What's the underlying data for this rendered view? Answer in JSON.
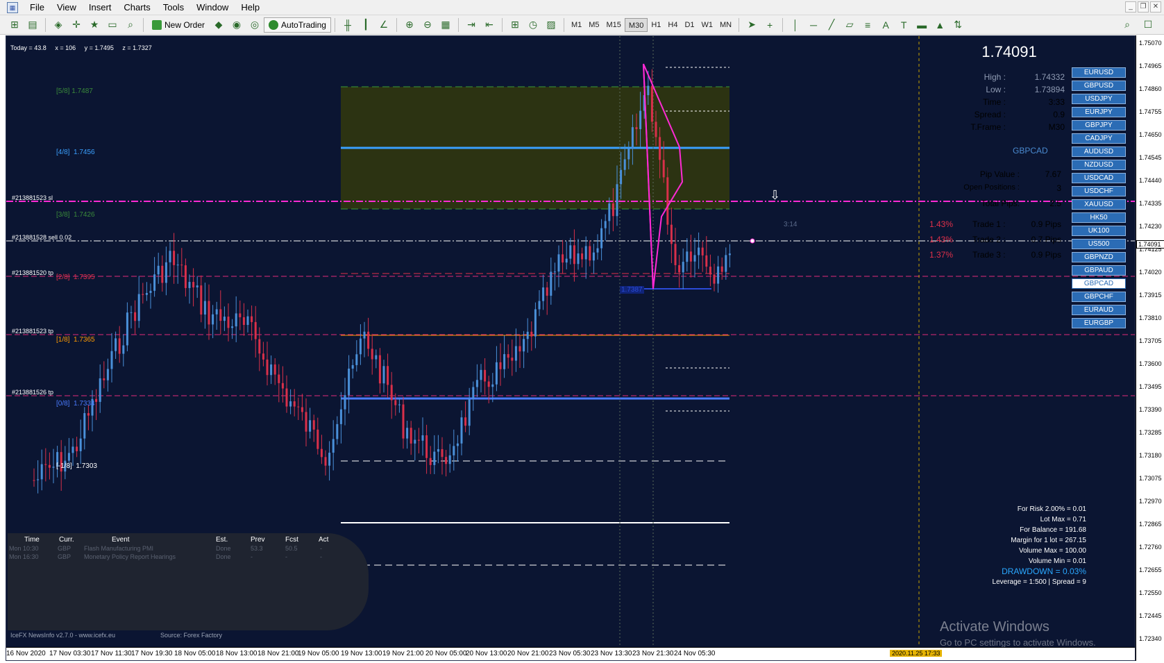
{
  "menu": {
    "app_icon": "mt4-icon",
    "items": [
      "File",
      "View",
      "Insert",
      "Charts",
      "Tools",
      "Window",
      "Help"
    ]
  },
  "toolbar": {
    "new_order_label": "New Order",
    "autotrading_label": "AutoTrading",
    "timeframes": [
      "M1",
      "M5",
      "M15",
      "M30",
      "H1",
      "H4",
      "D1",
      "W1",
      "MN"
    ],
    "active_timeframe": "M30"
  },
  "chart": {
    "info": {
      "today": "Today = 43.8",
      "x": "x = 106",
      "y": "y = 1.7495",
      "z": "z = 1.7327"
    },
    "murrey_levels": [
      {
        "label": "[5/8]",
        "value": "1.7487",
        "color": "#3a8a3a"
      },
      {
        "label": "[4/8]",
        "value": "1.7456",
        "color": "#3aa0ff"
      },
      {
        "label": "[3/8]",
        "value": "1.7426",
        "color": "#3a8a3a"
      },
      {
        "label": "[2/8]",
        "value": "1.7395",
        "color": "#e0304a"
      },
      {
        "label": "[1/8]",
        "value": "1.7365",
        "color": "#ff9a00"
      },
      {
        "label": "[0/8]",
        "value": "1.7334",
        "color": "#4a7bff"
      },
      {
        "label": "[-1/8]",
        "value": "1.7303",
        "color": "#ffffff"
      }
    ],
    "order_tags": [
      "#213881523 sl",
      "#213881528 sell 0.02",
      "#213881520 tp",
      "#213881523 tp",
      "#213881526 tp"
    ],
    "countdown": "3:14",
    "low_marker": "1.7387"
  },
  "panel": {
    "price": "1.74091",
    "high_label": "High :",
    "high": "1.74332",
    "low_label": "Low :",
    "low": "1.73894",
    "time_label": "Time :",
    "time": "3:33",
    "spread_label": "Spread :",
    "spread": "0.9",
    "tframe_label": "T.Frame :",
    "tframe": "M30",
    "symbol": "GBPCAD",
    "pip_value_label": "Pip Value :",
    "pip_value": "7.67",
    "open_pos_label": "Open Positions :",
    "open_pos": "3",
    "total_pips_label": "Total Pips:",
    "total_pips": "2.5",
    "trades": [
      {
        "pct": "1.43%",
        "label": "Trade 1 :",
        "pips": "0.9 Pips"
      },
      {
        "pct": "1.43%",
        "label": "Trade 2 :",
        "pips": "0.7 Pips"
      },
      {
        "pct": "1.37%",
        "label": "Trade 3 :",
        "pips": "0.9 Pips"
      }
    ]
  },
  "symbols": [
    "EURUSD",
    "GBPUSD",
    "USDJPY",
    "EURJPY",
    "GBPJPY",
    "CADJPY",
    "AUDUSD",
    "NZDUSD",
    "USDCAD",
    "USDCHF",
    "XAUUSD",
    "HK50",
    "UK100",
    "US500",
    "GBPNZD",
    "GBPAUD",
    "GBPCAD",
    "GBPCHF",
    "EURAUD",
    "EURGBP"
  ],
  "selected_symbol": "GBPCAD",
  "account": {
    "risk": "For Risk 2.00% = 0.01",
    "lot_max": "Lot Max = 0.71",
    "balance": "For Balance = 191.68",
    "margin": "Margin for 1 lot = 267.15",
    "vol_max": "Volume Max = 100.00",
    "vol_min": "Volume Min = 0.01",
    "drawdown": "DRAWDOWN =  0.03%",
    "leverage": "Leverage = 1:500 | Spread = 9"
  },
  "news": {
    "headers": [
      "Time",
      "Curr.",
      "Event",
      "Est.",
      "Prev",
      "Fcst",
      "Act"
    ],
    "rows": [
      [
        "Mon 10:30",
        "GBP",
        "Flash Manufacturing PMI",
        "Done",
        "53.3",
        "50.5",
        "-"
      ],
      [
        "Mon 16:30",
        "GBP",
        "Monetary Policy Report Hearings",
        "Done",
        "-",
        "-",
        "-"
      ]
    ],
    "footer_left": "IceFX NewsInfo v2.7.0  -  www.icefx.eu",
    "footer_right": "Source: Forex Factory"
  },
  "price_axis": {
    "ticks": [
      "1.75070",
      "1.74965",
      "1.74860",
      "1.74755",
      "1.74650",
      "1.74545",
      "1.74440",
      "1.74335",
      "1.74230",
      "1.74125",
      "1.74020",
      "1.73915",
      "1.73810",
      "1.73705",
      "1.73600",
      "1.73495",
      "1.73390",
      "1.73285",
      "1.73180",
      "1.73075",
      "1.72970",
      "1.72865",
      "1.72760",
      "1.72655",
      "1.72550",
      "1.72445",
      "1.72340"
    ],
    "current": "1.74091"
  },
  "time_axis": {
    "labels": [
      "16 Nov 2020",
      "17 Nov 03:30",
      "17 Nov 11:30",
      "17 Nov 19:30",
      "18 Nov 05:00",
      "18 Nov 13:00",
      "18 Nov 21:00",
      "19 Nov 05:00",
      "19 Nov 13:00",
      "19 Nov 21:00",
      "20 Nov 05:00",
      "20 Nov 13:00",
      "20 Nov 21:00",
      "23 Nov 05:30",
      "23 Nov 13:30",
      "23 Nov 21:30",
      "24 Nov 05:30"
    ],
    "badge": "2020.11.25 17:33"
  },
  "watermark": {
    "line1": "Activate Windows",
    "line2": "Go to PC settings to activate Windows."
  },
  "colors": {
    "chart_bg": "#0b1532",
    "bull_candle": "#4a90d9",
    "bear_candle": "#d9304a",
    "pattern": "#ff2ad4"
  }
}
